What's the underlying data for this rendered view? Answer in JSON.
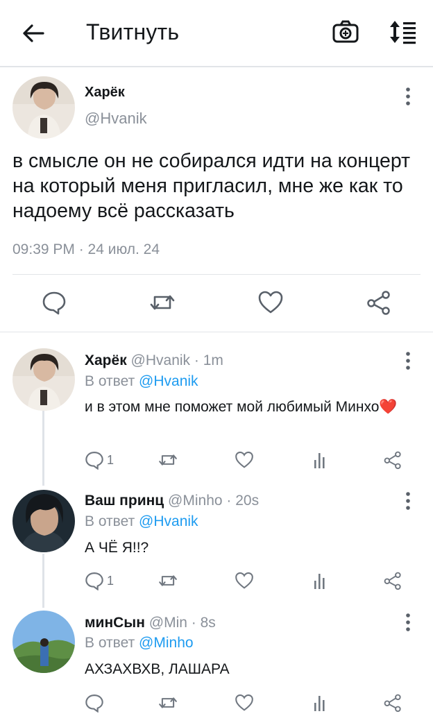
{
  "header": {
    "title": "Твитнуть",
    "back_icon": "back-arrow-icon",
    "camera_icon": "camera-icon",
    "sort_icon": "sort-icon"
  },
  "tweet": {
    "author_name": "Харёк",
    "author_handle": "@Hvanik",
    "text": "в смысле он не собирался идти на концерт на который меня пригласил, мне же как то надоему всё рассказать",
    "timestamp": "09:39 PM · 24 июл. 24"
  },
  "replies": [
    {
      "name": "Харёк",
      "meta": "@Hvanik · 1m",
      "reply_prefix": "В ответ ",
      "reply_to": "@Hvanik",
      "text": "и в этом мне поможет мой любимый Минхо",
      "emoji": "❤️",
      "reply_count": "1"
    },
    {
      "name": "Ваш принц",
      "meta": "@Minho · 20s",
      "reply_prefix": "В ответ ",
      "reply_to": "@Hvanik",
      "text": "А ЧЁ Я!!?",
      "reply_count": "1"
    },
    {
      "name": "минСын",
      "meta": "@Min · 8s",
      "reply_prefix": "В ответ ",
      "reply_to": "@Minho",
      "text": "АХЗАХВХВ, ЛАШАРА",
      "reply_count": ""
    }
  ],
  "colors": {
    "accent": "#1d9bf0",
    "secondary_text": "#8a9099",
    "heart": "#e8534f"
  }
}
